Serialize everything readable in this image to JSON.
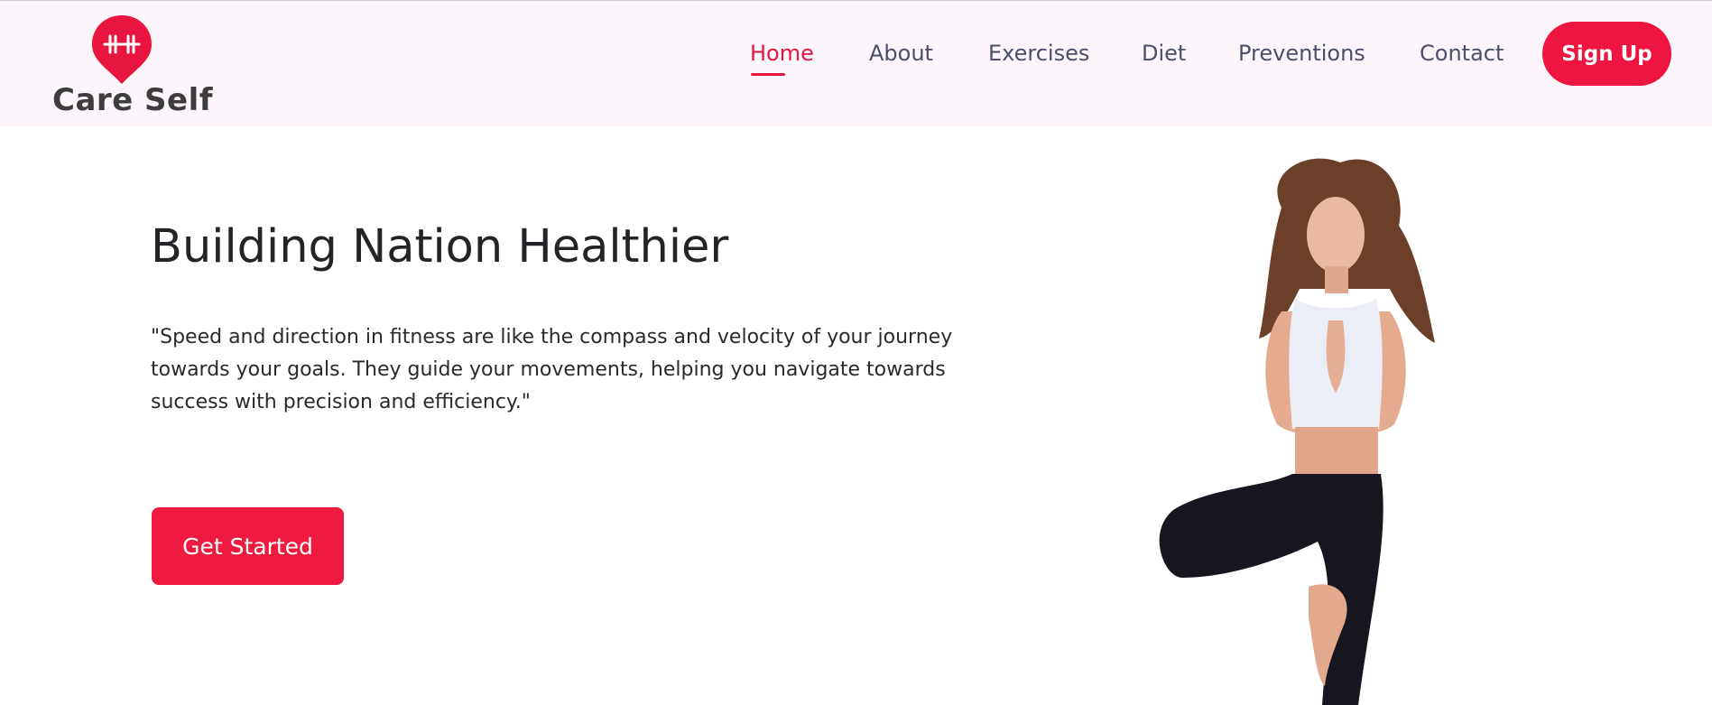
{
  "brand": {
    "name": "Care Self",
    "accent_color": "#ee1640",
    "logo_icon": "dumbbell-location-pin-icon"
  },
  "nav": {
    "items": [
      {
        "label": "Home",
        "active": true
      },
      {
        "label": "About",
        "active": false
      },
      {
        "label": "Exercises",
        "active": false
      },
      {
        "label": "Diet",
        "active": false
      },
      {
        "label": "Preventions",
        "active": false
      },
      {
        "label": "Contact",
        "active": false
      }
    ],
    "signup_label": "Sign Up"
  },
  "hero": {
    "title": "Building Nation Healthier",
    "quote": "\"Speed and direction in fitness are like the compass and velocity of your journey towards your goals. They guide your movements, helping you navigate towards success with precision and efficiency.\"",
    "cta_label": "Get Started",
    "image_subject": "woman in yoga tree pose with palms together"
  }
}
